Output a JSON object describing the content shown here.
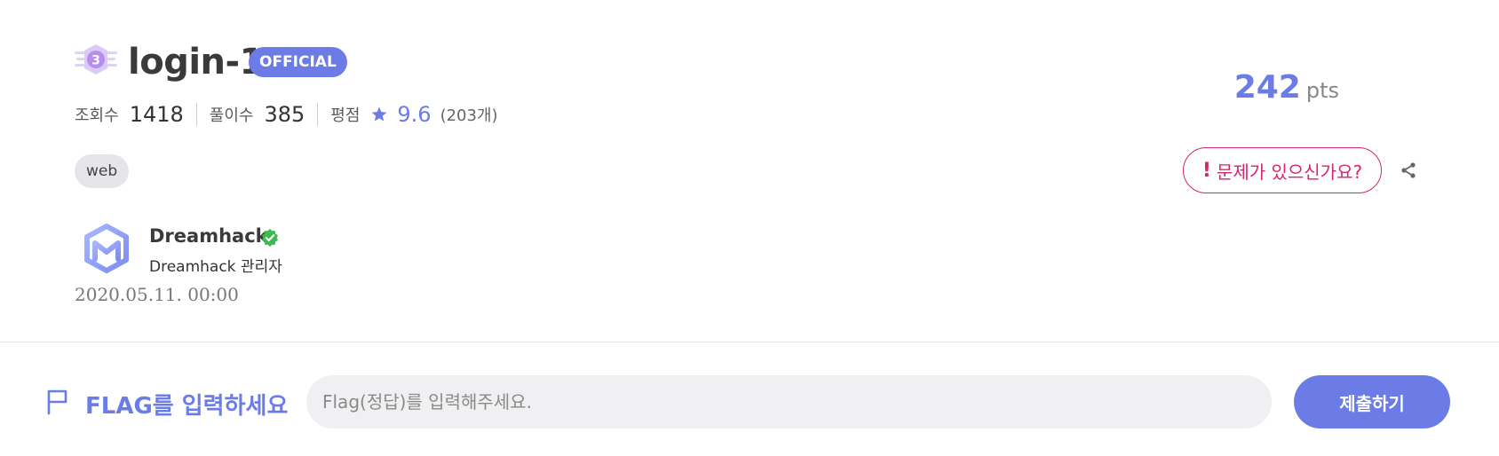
{
  "challenge": {
    "level_badge": "3",
    "title": "login-1",
    "official_badge": "OFFICIAL",
    "points": "242",
    "points_unit": "pts",
    "tag": "web"
  },
  "stats": {
    "views_label": "조회수",
    "views": "1418",
    "solves_label": "풀이수",
    "solves": "385",
    "rating_label": "평점",
    "rating": "9.6",
    "rating_count": "(203개)"
  },
  "actions": {
    "report_mark": "!",
    "report_label": "문제가 있으신가요?",
    "share_icon": "share-icon"
  },
  "author": {
    "name": "Dreamhack",
    "role": "Dreamhack 관리자",
    "date": "2020.05.11. 00:00",
    "verified_icon": "verified-badge-icon"
  },
  "flag": {
    "label": "FLAG를 입력하세요",
    "placeholder": "Flag(정답)를 입력해주세요.",
    "value": "",
    "submit_label": "제출하기"
  },
  "colors": {
    "accent": "#6c7ce7",
    "report": "#d6246e",
    "verified": "#3fb950",
    "tag_bg": "#e5e5ea",
    "input_bg": "#f0f0f3"
  }
}
